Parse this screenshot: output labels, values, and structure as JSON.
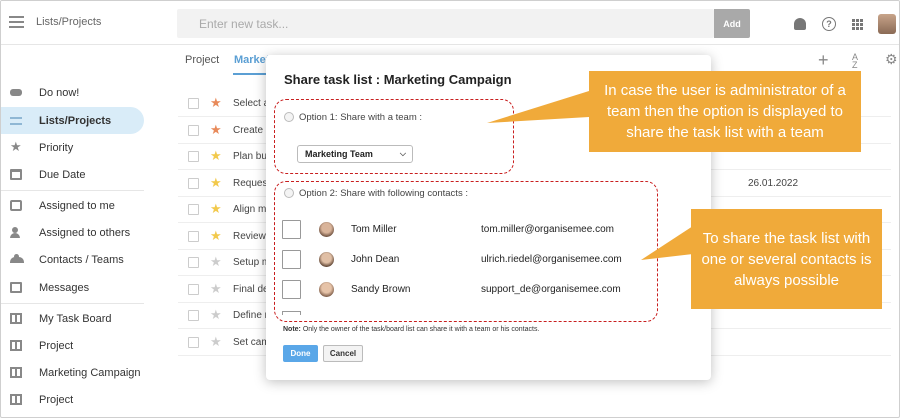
{
  "header": {
    "app_title": "Lists/Projects",
    "task_placeholder": "Enter new task...",
    "add_label": "Add",
    "help_glyph": "?"
  },
  "sidebar": {
    "items": [
      {
        "label": "Do now!",
        "icon": "gamepad-icon"
      },
      {
        "label": "Lists/Projects",
        "icon": "list-icon",
        "active": true
      },
      {
        "label": "Priority",
        "icon": "star-icon"
      },
      {
        "label": "Due Date",
        "icon": "calendar-icon"
      },
      {
        "label": "Assigned to me",
        "icon": "inbox-icon"
      },
      {
        "label": "Assigned to others",
        "icon": "person-icon"
      },
      {
        "label": "Contacts / Teams",
        "icon": "people-icon"
      },
      {
        "label": "Messages",
        "icon": "message-icon"
      },
      {
        "label": "My Task Board",
        "icon": "board-icon"
      },
      {
        "label": "Project",
        "icon": "board-icon"
      },
      {
        "label": "Marketing Campaign",
        "icon": "board-icon"
      },
      {
        "label": "Project",
        "icon": "board-icon"
      }
    ]
  },
  "tabs": [
    {
      "label": "Project"
    },
    {
      "label": "Marketi",
      "active": true
    }
  ],
  "toolbar": {
    "plus_glyph": "+",
    "sort_glyph_top": "A",
    "sort_glyph_bottom": "Z",
    "gear_glyph": "⚙"
  },
  "tasks": [
    {
      "name": "Select a",
      "star": "#e88a5a",
      "date": ""
    },
    {
      "name": "Create c",
      "star": "#e88a5a",
      "date": ""
    },
    {
      "name": "Plan bud",
      "star": "#f2c94c",
      "date": ""
    },
    {
      "name": "Request",
      "star": "#f2c94c",
      "date": "26.01.2022"
    },
    {
      "name": "Align ma",
      "star": "#f2c94c",
      "date": ""
    },
    {
      "name": "Review",
      "star": "#f2c94c",
      "date": ""
    },
    {
      "name": "Setup m",
      "star": "#cccccc",
      "date": ""
    },
    {
      "name": "Final de",
      "star": "#cccccc",
      "date": ""
    },
    {
      "name": "Define n",
      "star": "#cccccc",
      "date": ""
    },
    {
      "name": "Set cam",
      "star": "#cccccc",
      "date": ""
    }
  ],
  "modal": {
    "title": "Share task list : Marketing Campaign",
    "option1_label": "Option 1: Share with a team :",
    "team_selected": "Marketing Team",
    "option2_label": "Option 2: Share with following contacts :",
    "contacts": [
      {
        "name": "Tom Miller",
        "email": "tom.miller@organisemee.com"
      },
      {
        "name": "John Dean",
        "email": "ulrich.riedel@organisemee.com"
      },
      {
        "name": "Sandy Brown",
        "email": "support_de@organisemee.com"
      }
    ],
    "note_bold": "Note:",
    "note_text": " Only the owner of the task/board list can share it with a team or his contacts.",
    "done_label": "Done",
    "cancel_label": "Cancel"
  },
  "callouts": {
    "team": "In case the user is administrator of a team then the option is displayed to share the task list with a team",
    "contacts": "To share the task list with one or several contacts is always possible"
  },
  "colors": {
    "accent": "#5b9fd4",
    "callout": "#f0aa3a",
    "dash": "#c81e1e",
    "done_button": "#5aa7e8"
  }
}
